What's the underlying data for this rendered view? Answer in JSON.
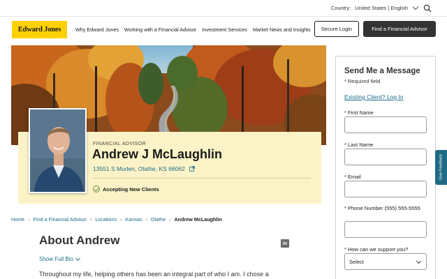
{
  "utility": {
    "country_label": "Country:",
    "country_value": "United States | English"
  },
  "nav": {
    "logo": "Edward Jones",
    "links": [
      "Why Edward Jones",
      "Working with a Financial Advisor",
      "Investment Services",
      "Market News and Insights"
    ],
    "login": "Secure Login",
    "find": "Find a Financial Advisor"
  },
  "profile": {
    "role": "FINANCIAL ADVISOR",
    "name": "Andrew J McLaughlin",
    "address": "13551 S Murlen, Olathe, KS 66062",
    "accepting": "Accepting New Clients"
  },
  "breadcrumb": [
    "Home",
    "Find a Financial Advisor",
    "Locations",
    "Kansas",
    "Olathe",
    "Andrew McLaughlin"
  ],
  "about": {
    "title": "About Andrew",
    "show_bio": "Show Full Bio",
    "bio_text": "Throughout my life, helping others has been an integral part of who I am. I chose a"
  },
  "form": {
    "title": "Send Me a Message",
    "required": "* Required field",
    "existing": "Existing Client? Log In",
    "first_name": "* First Name",
    "last_name": "* Last Name",
    "email": "* Email",
    "phone": "* Phone Number (555) 555-5555",
    "support": "* How can we support you?",
    "select_value": "Select"
  },
  "feedback": "Give Feedback",
  "icons": {
    "search": "search-icon",
    "external": "external-link-icon",
    "check": "check-circle-icon",
    "linkedin": "linkedin-icon",
    "chevron": "chevron-down-icon"
  },
  "colors": {
    "brand_yellow": "#fdd100",
    "link_teal": "#1b6c8c",
    "card_bg": "#fbf3c7",
    "dark_button": "#333333"
  }
}
